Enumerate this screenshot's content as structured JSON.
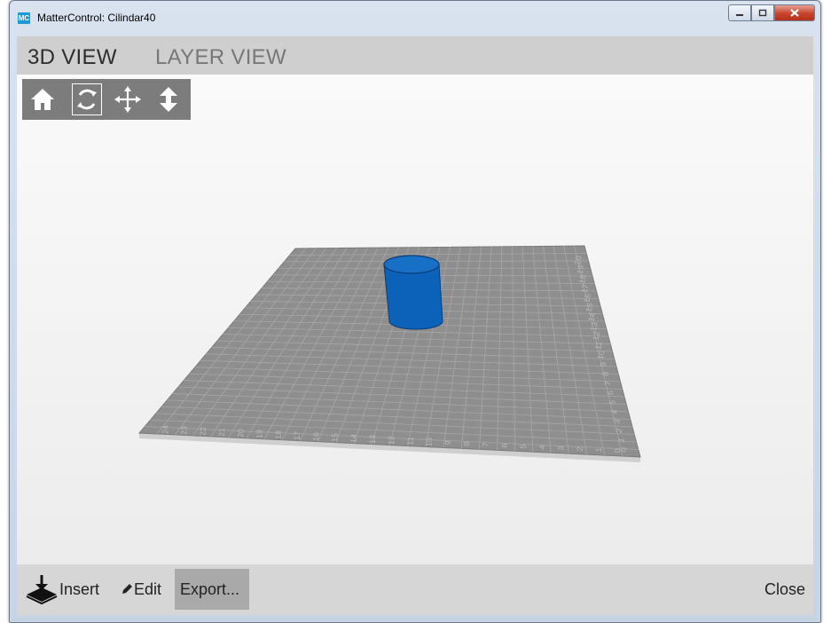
{
  "window": {
    "app_icon_text": "MC",
    "title": "MatterControl: Cilindar40"
  },
  "tabs": [
    {
      "label": "3D VIEW",
      "active": true
    },
    {
      "label": "LAYER VIEW",
      "active": false
    }
  ],
  "view_tools": [
    {
      "icon": "home-icon",
      "selected": false
    },
    {
      "icon": "rotate-icon",
      "selected": true
    },
    {
      "icon": "move-icon",
      "selected": false
    },
    {
      "icon": "zoom-icon",
      "selected": false
    }
  ],
  "bed": {
    "front_labels": [
      "24",
      "23",
      "22",
      "21",
      "20",
      "19",
      "18",
      "17",
      "16",
      "15",
      "14",
      "13",
      "12",
      "11",
      "10",
      "9",
      "8",
      "7",
      "6",
      "5",
      "4",
      "3",
      "2",
      "1",
      "0"
    ],
    "side_labels": [
      "0",
      "1",
      "2",
      "3",
      "4",
      "5",
      "6",
      "7",
      "8",
      "9",
      "10",
      "11",
      "12",
      "13",
      "14",
      "15",
      "16",
      "17",
      "18",
      "19",
      "20"
    ]
  },
  "object": {
    "color": "#0b62b8"
  },
  "bottom": {
    "insert_label": "Insert",
    "edit_label": "Edit",
    "export_label": "Export...",
    "close_label": "Close"
  }
}
